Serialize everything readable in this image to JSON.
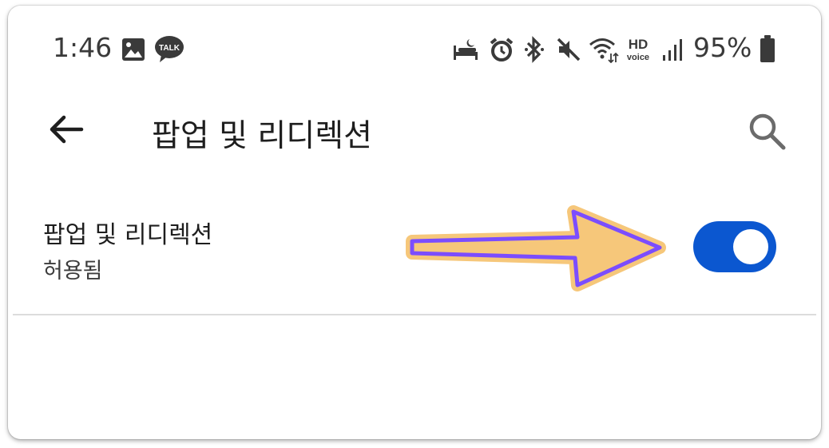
{
  "status_bar": {
    "time": "1:46",
    "battery_percent": "95%",
    "talk_badge": "TALK",
    "hd_label": "HD",
    "voice_label": "voice",
    "icons": [
      "gallery-icon",
      "kakaotalk-icon",
      "sleep-mode-icon",
      "alarm-icon",
      "bluetooth-icon",
      "mute-icon",
      "wifi-icon",
      "hd-voice-icon",
      "signal-icon",
      "battery-icon"
    ]
  },
  "toolbar": {
    "title": "팝업 및 리디렉션",
    "back_icon": "back-arrow-icon",
    "search_icon": "search-icon"
  },
  "setting": {
    "title": "팝업 및 리디렉션",
    "summary": "허용됨",
    "enabled": true
  },
  "annotation": {
    "type": "arrow",
    "fill_color": "#f6c77a",
    "outline_color": "#7b4dff"
  },
  "colors": {
    "toggle_on": "#0b57d0",
    "text_primary": "#1e1e1e",
    "status_text": "#3a3a3a"
  }
}
